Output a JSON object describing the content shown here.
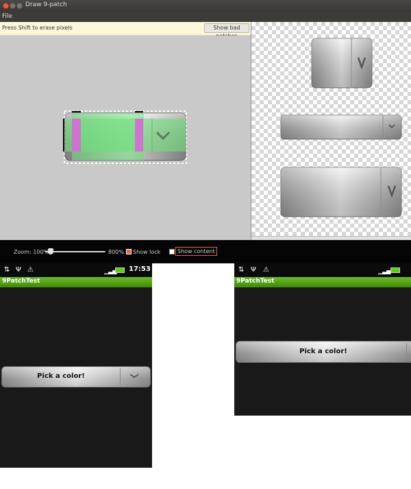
{
  "window": {
    "title": "Draw 9-patch",
    "menu": [
      "File"
    ],
    "hint": "Press Shift to erase pixels",
    "show_bad_patches": "Show bad patches"
  },
  "controls": {
    "zoom_label": "Zoom: 100%",
    "zoom_max": "800%",
    "show_lock": "Show lock",
    "show_lock_checked": true,
    "show_content": "Show content",
    "show_content_checked": false
  },
  "phones": [
    {
      "app_title": "9PatchTest",
      "clock": "17:53",
      "button_label": "Pick a color!"
    },
    {
      "app_title": "9PatchTest",
      "button_label": "Pick a color!"
    }
  ],
  "colors": {
    "app_bar": "#4f9c0e",
    "stretch_overlay": "#6ee07a",
    "fixed_overlay": "#d66ad6",
    "checkbox_accent": "#e06a3a"
  },
  "icons": {
    "dropdown": "chevron-down-icon",
    "status": [
      "usb-icon",
      "sync-icon",
      "warning-icon",
      "signal-icon",
      "battery-icon"
    ]
  }
}
